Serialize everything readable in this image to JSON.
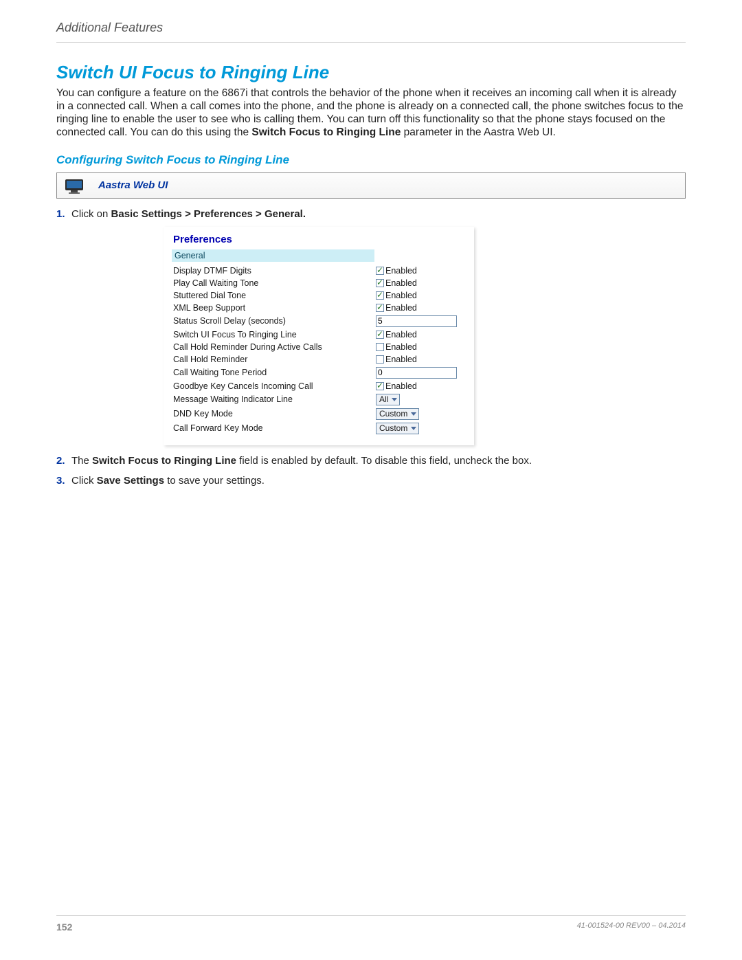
{
  "header": {
    "section": "Additional Features"
  },
  "title": "Switch UI Focus to Ringing Line",
  "intro": {
    "pre": "You can configure a feature on the 6867i that controls the behavior of the phone when it receives an incoming call when it is already in a connected call. When a call comes into the phone, and the phone is already on a connected call, the phone switches focus to the ringing line to enable the user to see who is calling them. You can turn off this functionality so that the phone stays focused on the connected call. You can do this using the ",
    "bold": "Switch Focus to Ringing Line",
    "post": " parameter in the Aastra Web UI."
  },
  "subhead": "Configuring Switch Focus to Ringing Line",
  "aastra_bar": "Aastra Web UI",
  "steps": {
    "s1_pre": "Click on ",
    "s1_bold": "Basic Settings > Preferences > General.",
    "s2_pre": "The ",
    "s2_bold": "Switch Focus to Ringing Line",
    "s2_post": " field is enabled by default. To disable this field, uncheck the box.",
    "s3_pre": "Click ",
    "s3_bold": "Save Settings",
    "s3_post": " to save your settings."
  },
  "prefs": {
    "title": "Preferences",
    "section": "General",
    "enabled_label": "Enabled",
    "rows": [
      {
        "label": "Display DTMF Digits",
        "type": "checkbox",
        "checked": true
      },
      {
        "label": "Play Call Waiting Tone",
        "type": "checkbox",
        "checked": true
      },
      {
        "label": "Stuttered Dial Tone",
        "type": "checkbox",
        "checked": true
      },
      {
        "label": "XML Beep Support",
        "type": "checkbox",
        "checked": true
      },
      {
        "label": "Status Scroll Delay (seconds)",
        "type": "text",
        "value": "5"
      },
      {
        "label": "Switch UI Focus To Ringing Line",
        "type": "checkbox",
        "checked": true
      },
      {
        "label": "Call Hold Reminder During Active Calls",
        "type": "checkbox",
        "checked": false
      },
      {
        "label": "Call Hold Reminder",
        "type": "checkbox",
        "checked": false
      },
      {
        "label": "Call Waiting Tone Period",
        "type": "text",
        "value": "0"
      },
      {
        "label": "Goodbye Key Cancels Incoming Call",
        "type": "checkbox",
        "checked": true
      },
      {
        "label": "Message Waiting Indicator Line",
        "type": "select",
        "value": "All"
      },
      {
        "label": "DND Key Mode",
        "type": "select",
        "value": "Custom"
      },
      {
        "label": "Call Forward Key Mode",
        "type": "select",
        "value": "Custom"
      }
    ]
  },
  "footer": {
    "page": "152",
    "docid": "41-001524-00 REV00 – 04.2014"
  }
}
